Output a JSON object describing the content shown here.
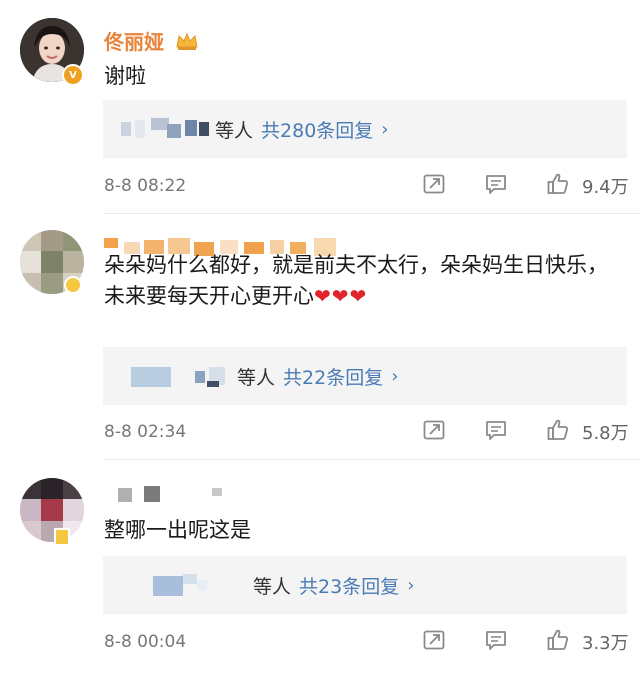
{
  "comments": [
    {
      "username": "佟丽娅",
      "text": "谢啦",
      "reply_prefix": "等人",
      "reply_count": "共280条回复",
      "time": "8-8 08:22",
      "likes": "9.4万",
      "colors": {
        "username": "#e8853a",
        "badge": "#f0a020"
      }
    },
    {
      "username": "",
      "text": "朵朵妈什么都好，就是前夫不太行，朵朵妈生日快乐，未来要每天开心更开心",
      "hearts": "❤❤❤",
      "reply_prefix": "等人",
      "reply_count": "共22条回复",
      "time": "8-8 02:34",
      "likes": "5.8万",
      "colors": {
        "username": "#f0a030"
      }
    },
    {
      "username": "",
      "text": "整哪一出呢这是",
      "reply_prefix": "等人",
      "reply_count": "共23条回复",
      "time": "8-8 00:04",
      "likes": "3.3万"
    }
  ],
  "icons": [
    "crown-icon",
    "verified-badge-icon",
    "share-icon",
    "comment-icon",
    "like-icon",
    "chevron-right-icon"
  ],
  "chevron": "›"
}
